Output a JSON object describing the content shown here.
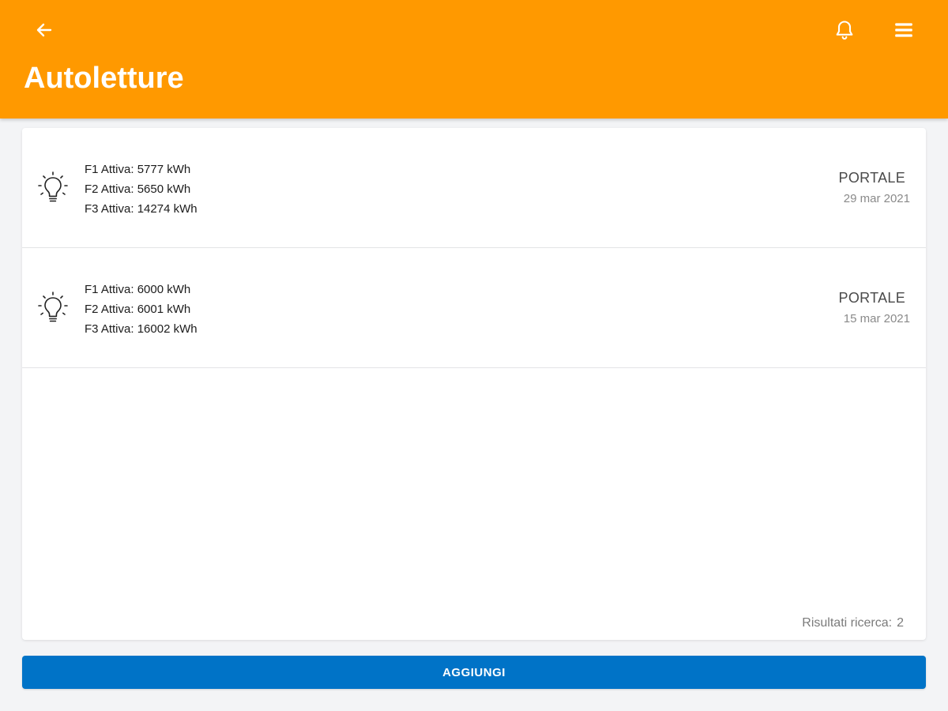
{
  "header": {
    "title": "Autoletture",
    "back_icon": "arrow-left-icon",
    "notifications_icon": "bell-icon",
    "menu_icon": "hamburger-menu-icon",
    "background_color": "#ff9900"
  },
  "readings": [
    {
      "icon": "lightbulb-icon",
      "lines": [
        "F1 Attiva: 5777 kWh",
        "F2 Attiva: 5650 kWh",
        "F3 Attiva: 14274 kWh"
      ],
      "source": "PORTALE",
      "date": "29 mar 2021"
    },
    {
      "icon": "lightbulb-icon",
      "lines": [
        "F1 Attiva: 6000 kWh",
        "F2 Attiva: 6001 kWh",
        "F3 Attiva: 16002 kWh"
      ],
      "source": "PORTALE",
      "date": "15 mar 2021"
    }
  ],
  "results": {
    "label": "Risultati ricerca:",
    "count": "2"
  },
  "add_button": {
    "label": "AGGIUNGI",
    "color": "#0073c7"
  }
}
